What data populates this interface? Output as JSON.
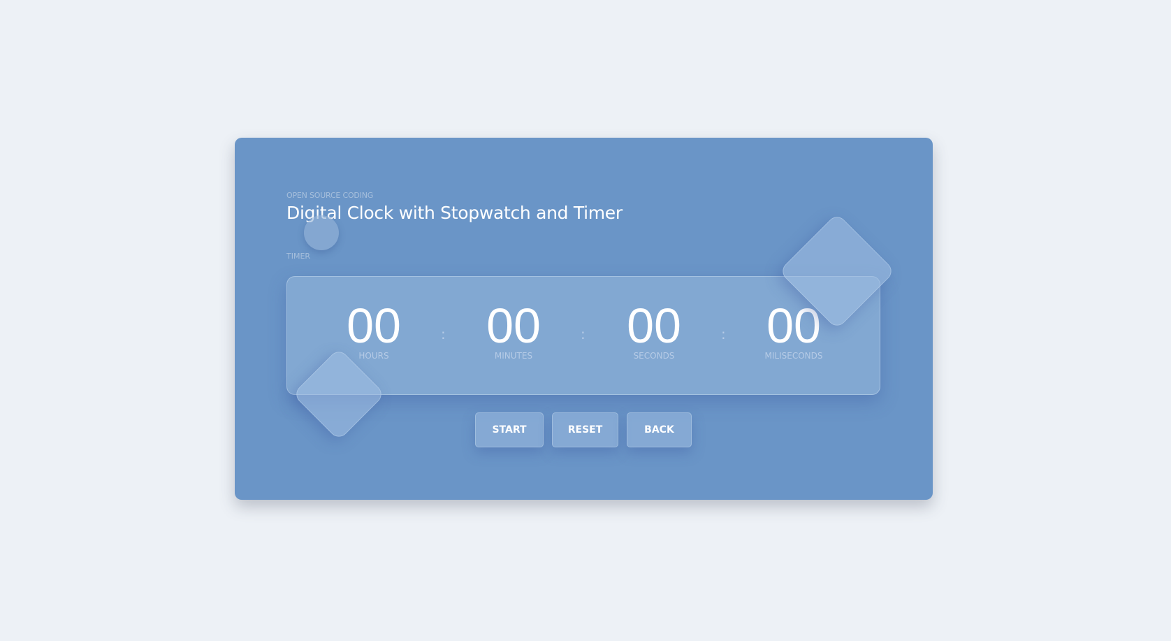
{
  "header": {
    "subtitle": "OPEN SOURCE CODING",
    "title": "Digital Clock with Stopwatch and Timer"
  },
  "section_label": "TIMER",
  "timer": {
    "units": [
      {
        "value": "00",
        "label": "HOURS"
      },
      {
        "value": "00",
        "label": "MINUTES"
      },
      {
        "value": "00",
        "label": "SECONDS"
      },
      {
        "value": "00",
        "label": "MILISECONDS"
      }
    ],
    "separator": ":"
  },
  "buttons": {
    "start": "START",
    "reset": "RESET",
    "back": "BACK"
  }
}
